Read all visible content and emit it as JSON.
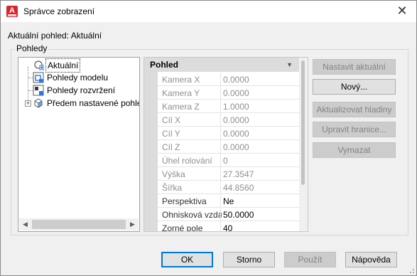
{
  "window": {
    "title": "Správce zobrazení",
    "current_view_label": "Aktuální pohled: Aktuální"
  },
  "views_group": {
    "label": "Pohledy",
    "tree": [
      {
        "label": "Aktuální",
        "icon": "current-view-icon",
        "selected": true
      },
      {
        "label": "Pohledy modelu",
        "icon": "model-views-icon"
      },
      {
        "label": "Pohledy rozvržení",
        "icon": "layout-views-icon"
      },
      {
        "label": "Předem nastavené pohledy",
        "icon": "preset-views-icon",
        "expandable": true
      }
    ]
  },
  "properties": {
    "section": "Pohled",
    "rows": [
      {
        "name": "Kamera X",
        "value": "0.0000"
      },
      {
        "name": "Kamera Y",
        "value": "0.0000"
      },
      {
        "name": "Kamera Z",
        "value": "1.0000"
      },
      {
        "name": "Cíl X",
        "value": "0.0000"
      },
      {
        "name": "Cíl Y",
        "value": "0.0000"
      },
      {
        "name": "Cíl Z",
        "value": "0.0000"
      },
      {
        "name": "Úhel rolování",
        "value": "0"
      },
      {
        "name": "Výška",
        "value": "27.3547"
      },
      {
        "name": "Šířka",
        "value": "44.8560"
      },
      {
        "name": "Perspektiva",
        "value": "Ne",
        "active": true
      },
      {
        "name": "Ohnisková vzdálenost",
        "value": "50.0000",
        "active": true
      },
      {
        "name": "Zorné pole",
        "value": "40",
        "active": true
      }
    ]
  },
  "side_buttons": [
    {
      "label": "Nastavit aktuální",
      "enabled": false
    },
    {
      "label": "Nový...",
      "enabled": true
    },
    {
      "label": "Aktualizovat hladiny",
      "enabled": false
    },
    {
      "label": "Upravit hranice...",
      "enabled": false
    },
    {
      "label": "Vymazat",
      "enabled": false
    }
  ],
  "bottom_buttons": {
    "ok": "OK",
    "cancel": "Storno",
    "apply": "Použít",
    "help": "Nápověda"
  }
}
